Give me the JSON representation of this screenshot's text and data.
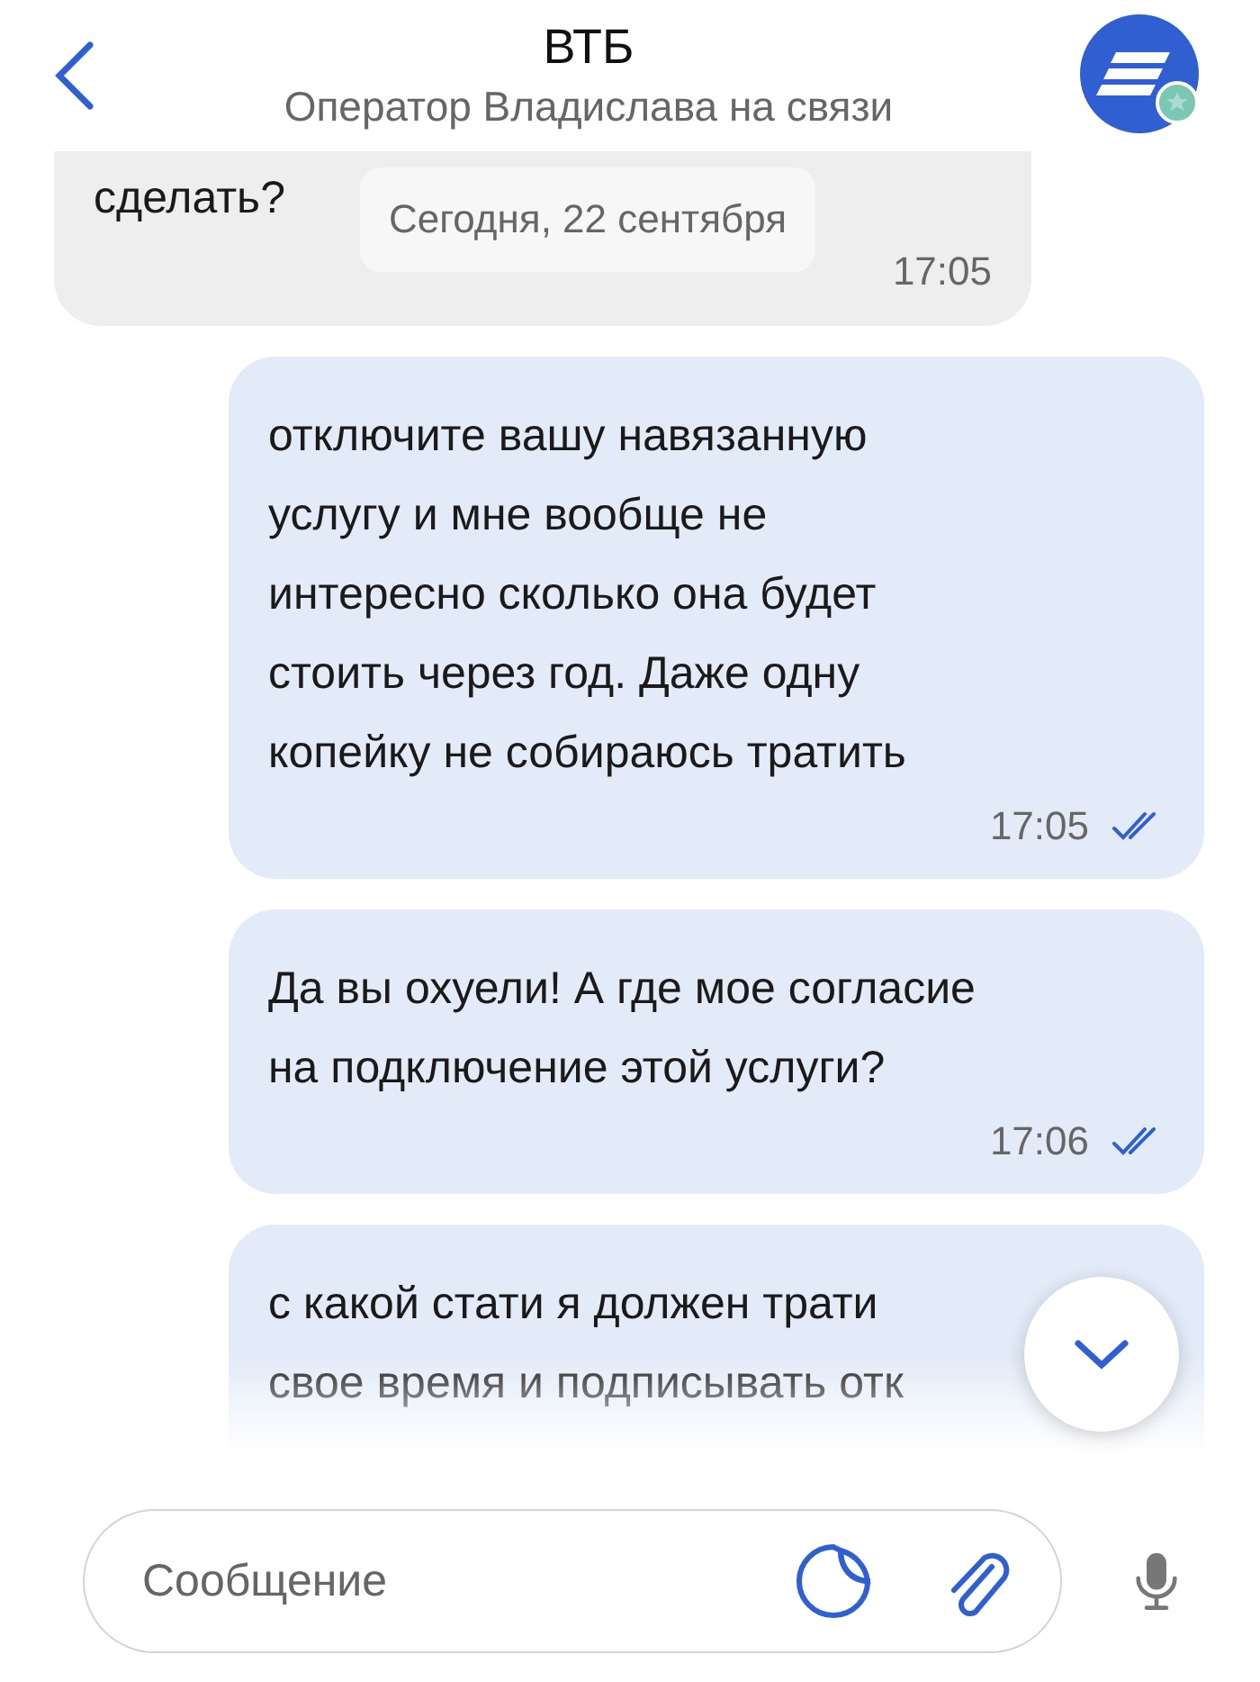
{
  "header": {
    "title": "ВТБ",
    "subtitle": "Оператор Владислава на связи"
  },
  "date_chip": "Сегодня, 22 сентября",
  "messages": [
    {
      "kind": "incoming",
      "text": "сделать?",
      "time": "17:05"
    },
    {
      "kind": "outgoing",
      "text": "отключите вашу навязанную\nуслугу и мне вообще не\nинтересно сколько она будет\nстоить через год. Даже одну\nкопейку не собираюсь тратить",
      "time": "17:05",
      "read": true
    },
    {
      "kind": "outgoing",
      "text": "Да вы охуели! А где мое согласие\nна подключение этой услуги?",
      "time": "17:06",
      "read": true
    },
    {
      "kind": "outgoing",
      "text": "с какой стати я должен трати\nсвое время и подписывать отк"
    }
  ],
  "composer": {
    "placeholder": "Сообщение"
  }
}
